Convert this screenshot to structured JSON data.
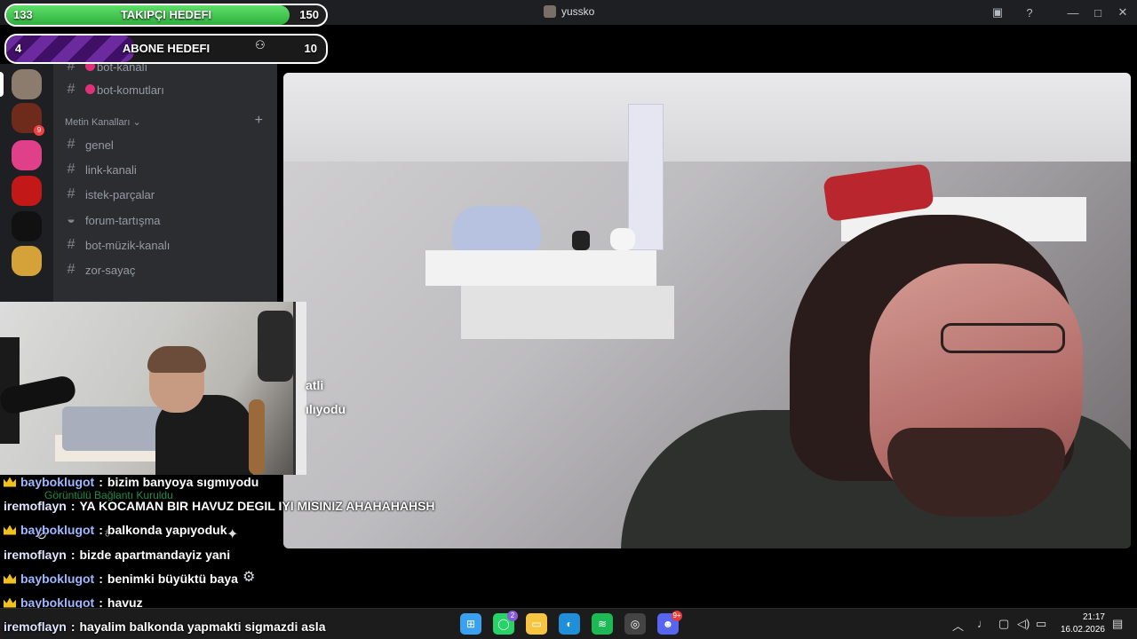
{
  "window": {
    "title": "yussko"
  },
  "goals": {
    "follow": {
      "label": "TAKIPÇI HEDEFI",
      "current": "133",
      "target": "150",
      "progress": 0.887,
      "color": "#3cc24a"
    },
    "subs": {
      "label": "ABONE HEDEFI",
      "current": "4",
      "target": "10",
      "progress": 0.4,
      "color": "#5a2189"
    }
  },
  "channels": {
    "partial_top": "bot-kanalı",
    "top": [
      {
        "name": "bot-komutları"
      }
    ],
    "category": "Metin Kanalları",
    "items": [
      {
        "name": "genel",
        "icon": "hash-icon"
      },
      {
        "name": "link-kanali",
        "icon": "hash-icon"
      },
      {
        "name": "istek-parçalar",
        "icon": "music-hash-icon"
      },
      {
        "name": "forum-tartışma",
        "icon": "forum-icon"
      },
      {
        "name": "bot-müzik-kanalı",
        "icon": "hash-icon"
      },
      {
        "name": "zor-sayaç",
        "icon": "hash-icon"
      }
    ]
  },
  "servers": [
    {
      "name": "server-1",
      "color": "#8c7c6e"
    },
    {
      "name": "server-2",
      "color": "#6e2a1a",
      "badge": "9"
    },
    {
      "name": "server-3",
      "color": "#e0408a"
    },
    {
      "name": "server-4",
      "color": "#c21818"
    },
    {
      "name": "server-5",
      "color": "#111111"
    },
    {
      "name": "server-6",
      "color": "#d5a23a"
    }
  ],
  "video_text": {
    "t1": "atli",
    "t2": "ılıyodu"
  },
  "voice": {
    "status": "Görüntülü Bağlantı Kuruldu"
  },
  "chat": [
    {
      "user": "bayboklugot",
      "crown": true,
      "msg": "bizim banyoya sıgmıyodu"
    },
    {
      "user": "iremoflayn",
      "crown": false,
      "msg": "YA KOCAMAN BIR HAVUZ DEGIL IYI MISINIZ AHAHAHAHSH"
    },
    {
      "user": "bayboklugot",
      "crown": true,
      "msg": "balkonda yapıyoduk"
    },
    {
      "user": "iremoflayn",
      "crown": false,
      "msg": "bizde apartmandayiz yani"
    },
    {
      "user": "bayboklugot",
      "crown": true,
      "msg": "benimki büyüktü baya"
    },
    {
      "user": "bayboklugot",
      "crown": true,
      "msg": "havuz"
    },
    {
      "user": "iremoflayn",
      "crown": false,
      "msg": "hayalim balkonda yapmakti sigmazdi asla"
    }
  ],
  "taskbar": {
    "apps": [
      {
        "name": "windows-start-icon",
        "color": "#3aa0f0"
      },
      {
        "name": "whatsapp-icon",
        "color": "#25d366",
        "badge": "2"
      },
      {
        "name": "file-explorer-icon",
        "color": "#f5c542"
      },
      {
        "name": "edge-icon",
        "color": "#1e8fd8"
      },
      {
        "name": "spotify-icon",
        "color": "#1db954"
      },
      {
        "name": "obs-icon",
        "color": "#444444"
      },
      {
        "name": "discord-icon",
        "color": "#5865f2",
        "badge": "9+"
      }
    ],
    "time": "21:17",
    "date": "16.02.2026"
  }
}
